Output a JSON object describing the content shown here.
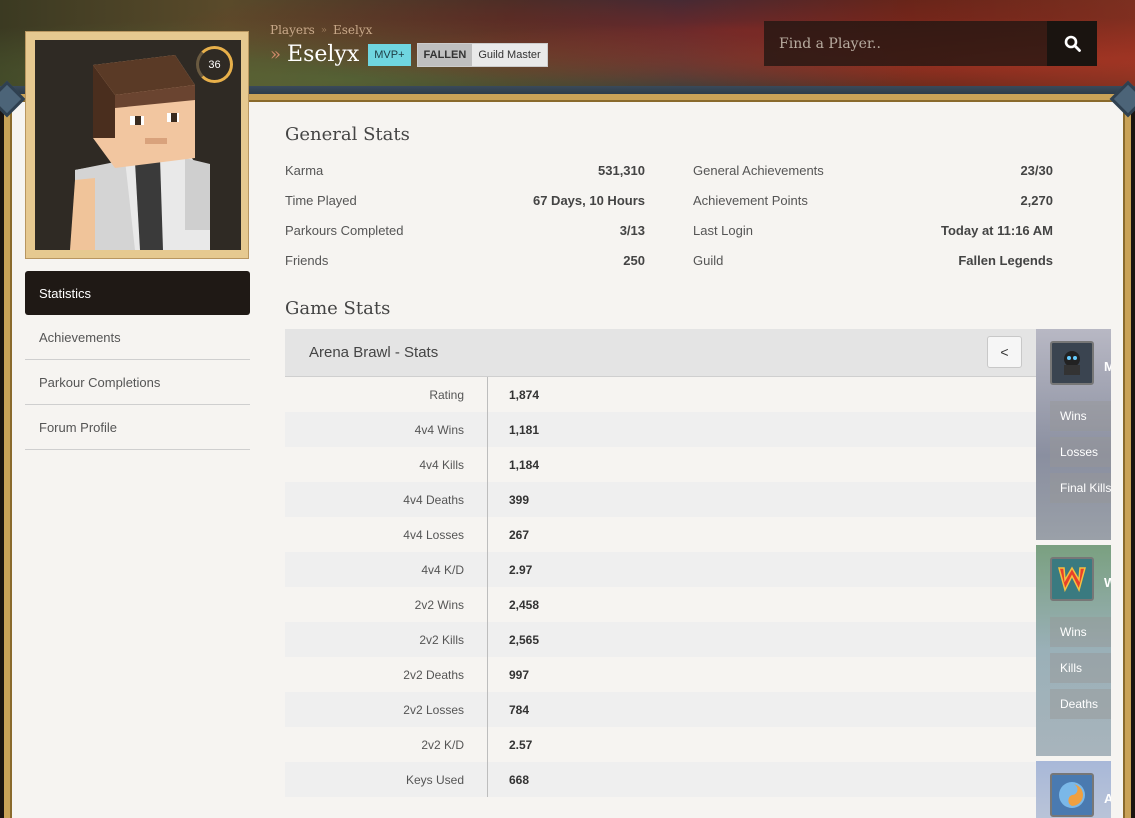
{
  "header": {
    "breadcrumb": [
      "Players",
      "Eselyx"
    ],
    "player_name": "Eselyx",
    "rank": "MVP+",
    "guild_tag": "FALLEN",
    "guild_role": "Guild Master",
    "title_chevron": "»",
    "breadcrumb_sep": "»"
  },
  "search": {
    "placeholder": "Find a Player..",
    "icon": "search-icon"
  },
  "avatar": {
    "level": "36"
  },
  "sidebar": {
    "items": [
      {
        "label": "Statistics",
        "active": true
      },
      {
        "label": "Achievements"
      },
      {
        "label": "Parkour Completions"
      },
      {
        "label": "Forum Profile"
      }
    ]
  },
  "general_stats": {
    "title": "General Stats",
    "left": [
      {
        "label": "Karma",
        "value": "531,310"
      },
      {
        "label": "Time Played",
        "value": "67 Days, 10 Hours"
      },
      {
        "label": "Parkours Completed",
        "value": "3/13"
      },
      {
        "label": "Friends",
        "value": "250"
      }
    ],
    "right": [
      {
        "label": "General Achievements",
        "value": "23/30"
      },
      {
        "label": "Achievement Points",
        "value": "2,270"
      },
      {
        "label": "Last Login",
        "value": "Today at 11:16 AM"
      },
      {
        "label": "Guild",
        "value": "Fallen Legends"
      }
    ]
  },
  "game_stats": {
    "title": "Game Stats",
    "panel_title": "Arena Brawl - Stats",
    "back_label": "<",
    "rows": [
      {
        "label": "Rating",
        "value": "1,874"
      },
      {
        "label": "4v4 Wins",
        "value": "1,181"
      },
      {
        "label": "4v4 Kills",
        "value": "1,184"
      },
      {
        "label": "4v4 Deaths",
        "value": "399"
      },
      {
        "label": "4v4 Losses",
        "value": "267"
      },
      {
        "label": "4v4 K/D",
        "value": "2.97"
      },
      {
        "label": "2v2 Wins",
        "value": "2,458"
      },
      {
        "label": "2v2 Kills",
        "value": "2,565"
      },
      {
        "label": "2v2 Deaths",
        "value": "997"
      },
      {
        "label": "2v2 Losses",
        "value": "784"
      },
      {
        "label": "2v2 K/D",
        "value": "2.57"
      },
      {
        "label": "Keys Used",
        "value": "668"
      }
    ]
  },
  "side_cards": [
    {
      "letter": "M",
      "stats": [
        "Wins",
        "Losses",
        "Final Kills"
      ]
    },
    {
      "letter": "W",
      "stats": [
        "Wins",
        "Kills",
        "Deaths"
      ]
    },
    {
      "letter": "A",
      "stats": []
    }
  ],
  "colors": {
    "accent_gold": "#c9a257",
    "rank_mvp_plus": "#6fd6e0",
    "active_nav": "#1f1915"
  }
}
